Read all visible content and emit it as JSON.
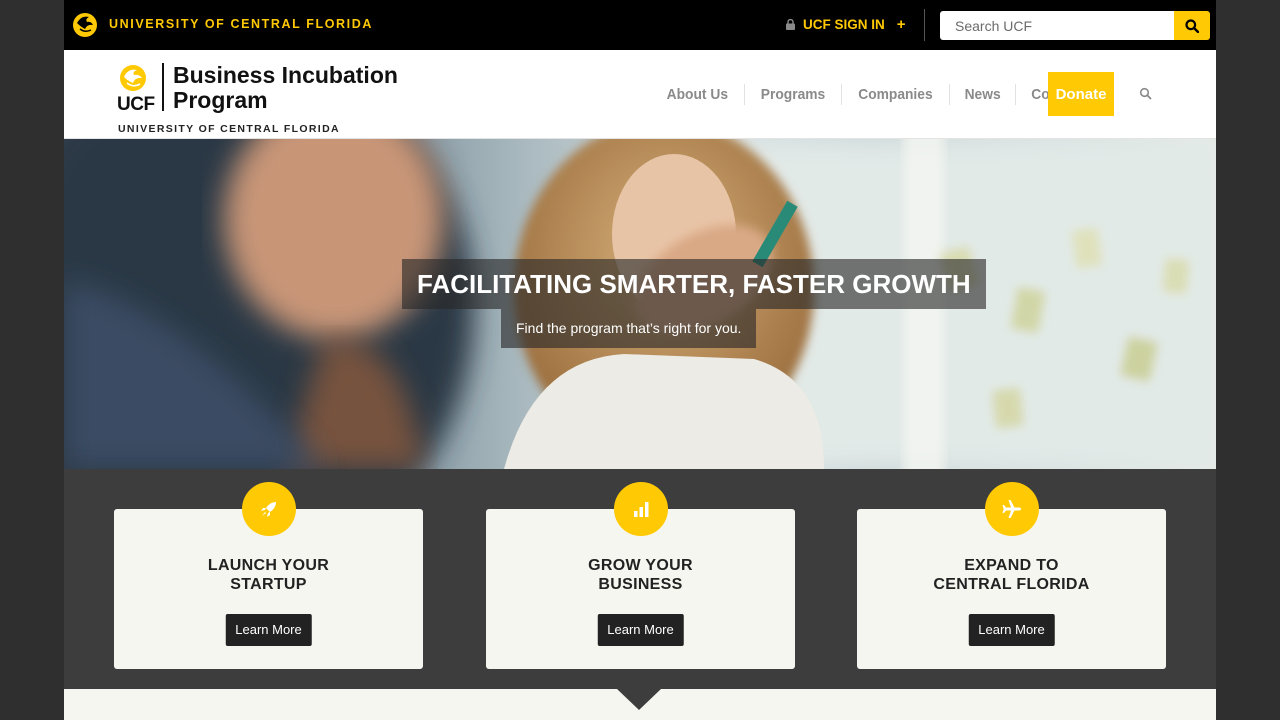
{
  "ucf_bar": {
    "name": "UNIVERSITY OF CENTRAL FLORIDA",
    "signin_prefix": "UCF",
    "signin_label": "SIGN IN",
    "signin_plus": "+",
    "search_placeholder": "Search UCF"
  },
  "header": {
    "logo_ucf": "UCF",
    "logo_title": "Business Incubation Program",
    "logo_subtitle": "UNIVERSITY OF CENTRAL FLORIDA",
    "nav": [
      {
        "label": "About Us"
      },
      {
        "label": "Programs"
      },
      {
        "label": "Companies"
      },
      {
        "label": "News"
      },
      {
        "label": "Contact"
      }
    ],
    "donate": "Donate"
  },
  "hero": {
    "title": "FACILITATING SMARTER, FASTER GROWTH",
    "subtitle": "Find the program that’s right for you."
  },
  "features": [
    {
      "line1": "LAUNCH YOUR",
      "line2": "STARTUP",
      "button": "Learn More",
      "icon": "rocket-icon"
    },
    {
      "line1": "GROW YOUR",
      "line2": "BUSINESS",
      "button": "Learn More",
      "icon": "bar-chart-icon"
    },
    {
      "line1": "EXPAND TO",
      "line2": "CENTRAL FLORIDA",
      "button": "Learn More",
      "icon": "airplane-icon"
    }
  ],
  "colors": {
    "ucf_gold": "#ffc904",
    "black": "#000000",
    "dark_gray": "#3d3d3d",
    "card_bg": "#f6f6f1"
  }
}
